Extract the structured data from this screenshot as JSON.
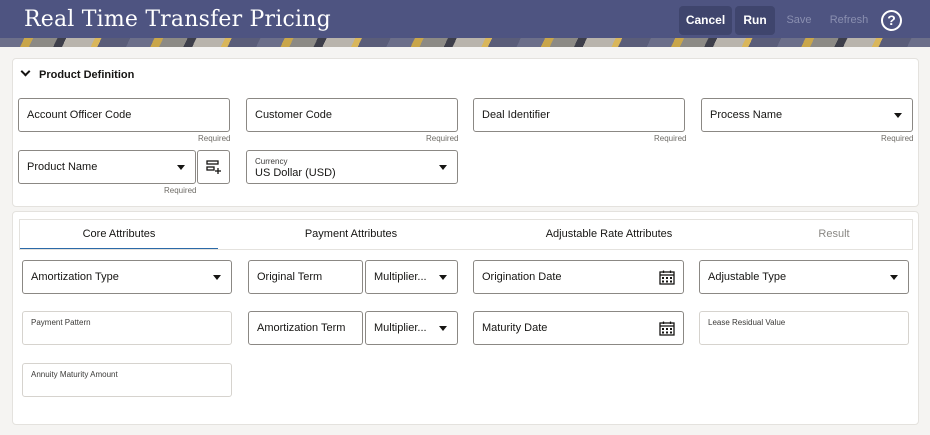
{
  "header": {
    "title": "Real Time Transfer Pricing",
    "cancel_label": "Cancel",
    "run_label": "Run",
    "save_label": "Save",
    "refresh_label": "Refresh",
    "help_label": "?"
  },
  "product_definition": {
    "section_title": "Product Definition",
    "account_officer_code": {
      "label": "Account Officer Code",
      "hint": "Required"
    },
    "customer_code": {
      "label": "Customer Code",
      "hint": "Required"
    },
    "deal_identifier": {
      "label": "Deal Identifier",
      "hint": "Required"
    },
    "process_name": {
      "label": "Process Name",
      "hint": "Required"
    },
    "product_name": {
      "label": "Product Name",
      "hint": "Required"
    },
    "currency": {
      "label": "Currency",
      "value": "US Dollar (USD)"
    }
  },
  "tabs": [
    {
      "label": "Core Attributes",
      "state": "active"
    },
    {
      "label": "Payment Attributes",
      "state": "normal"
    },
    {
      "label": "Adjustable Rate Attributes",
      "state": "normal"
    },
    {
      "label": "Result",
      "state": "disabled"
    }
  ],
  "core_attributes": {
    "amortization_type": "Amortization Type",
    "original_term": "Original Term",
    "original_term_multiplier": "Multiplier...",
    "origination_date": "Origination Date",
    "adjustable_type": "Adjustable Type",
    "payment_pattern": "Payment Pattern",
    "amortization_term": "Amortization Term",
    "amortization_term_multiplier": "Multiplier...",
    "maturity_date": "Maturity Date",
    "lease_residual_value": "Lease Residual Value",
    "annuity_maturity_amount": "Annuity Maturity Amount"
  },
  "colors": {
    "header_bg": "#4e5481",
    "active_tab_underline": "#2b6aa8"
  }
}
